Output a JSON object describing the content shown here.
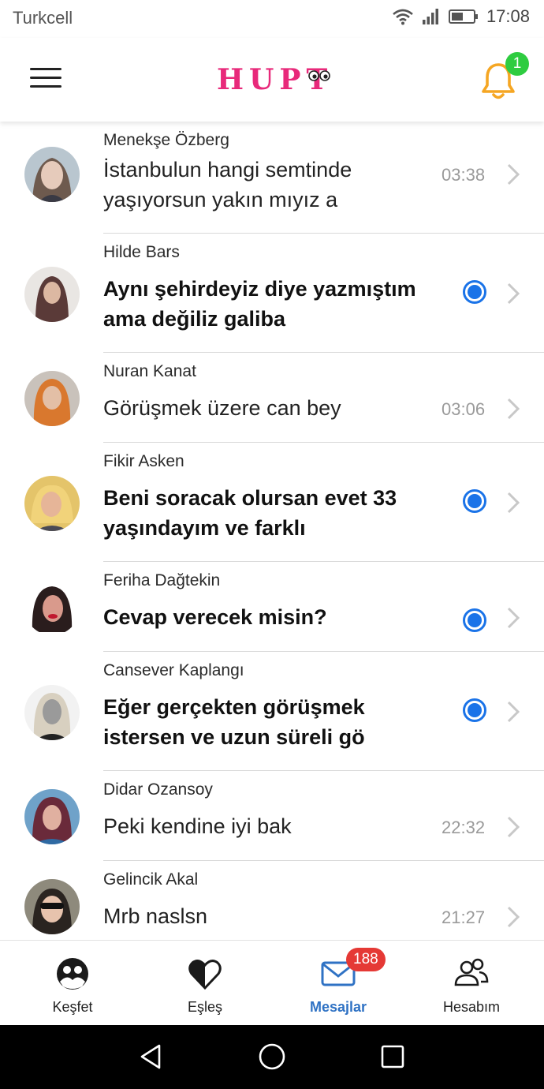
{
  "status_bar": {
    "carrier": "Turkcell",
    "time": "17:08"
  },
  "header": {
    "logo_text": "HUPT",
    "notification_count": "1",
    "colors": {
      "logo": "#e8297a",
      "bell": "#f5a623",
      "badge": "#2ecc40"
    }
  },
  "conversations": [
    {
      "name": "Menekşe Özberg",
      "message_line1": "İstanbulun hangi semtinde",
      "message_line2": "yaşıyorsun yakın mıyız a",
      "time": "03:38",
      "unread": false
    },
    {
      "name": "Hilde Bars",
      "message_line1": "Aynı şehirdeyiz diye yazmıştım",
      "message_line2": "ama değiliz galiba",
      "time": "",
      "unread": true
    },
    {
      "name": "Nuran Kanat",
      "message_line1": "Görüşmek üzere can bey",
      "message_line2": "",
      "time": "03:06",
      "unread": false
    },
    {
      "name": "Fikir Asken",
      "message_line1": "Beni soracak olursan evet 33",
      "message_line2": "yaşındayım ve farklı",
      "time": "",
      "unread": true
    },
    {
      "name": "Feriha Dağtekin",
      "message_line1": "Cevap verecek misin?",
      "message_line2": "",
      "time": "",
      "unread": true
    },
    {
      "name": "Cansever Kaplangı",
      "message_line1": "Eğer gerçekten görüşmek",
      "message_line2": "istersen ve uzun süreli gö",
      "time": "",
      "unread": true
    },
    {
      "name": "Didar Ozansoy",
      "message_line1": "Peki kendine iyi bak",
      "message_line2": "",
      "time": "22:32",
      "unread": false
    },
    {
      "name": "Gelincik Akal",
      "message_line1": "Mrb naslsn",
      "message_line2": "",
      "time": "21:27",
      "unread": false
    }
  ],
  "bottom_nav": {
    "items": [
      {
        "label": "Keşfet",
        "icon": "discover-icon"
      },
      {
        "label": "Eşleş",
        "icon": "heart-icon"
      },
      {
        "label": "Mesajlar",
        "icon": "mail-icon"
      },
      {
        "label": "Hesabım",
        "icon": "users-icon"
      }
    ],
    "active": "Mesajlar",
    "messages_badge": "188",
    "colors": {
      "active": "#2f72c4",
      "badge": "#e53935"
    }
  },
  "android_nav": {
    "buttons": [
      "back-icon",
      "home-icon",
      "recents-icon"
    ]
  }
}
